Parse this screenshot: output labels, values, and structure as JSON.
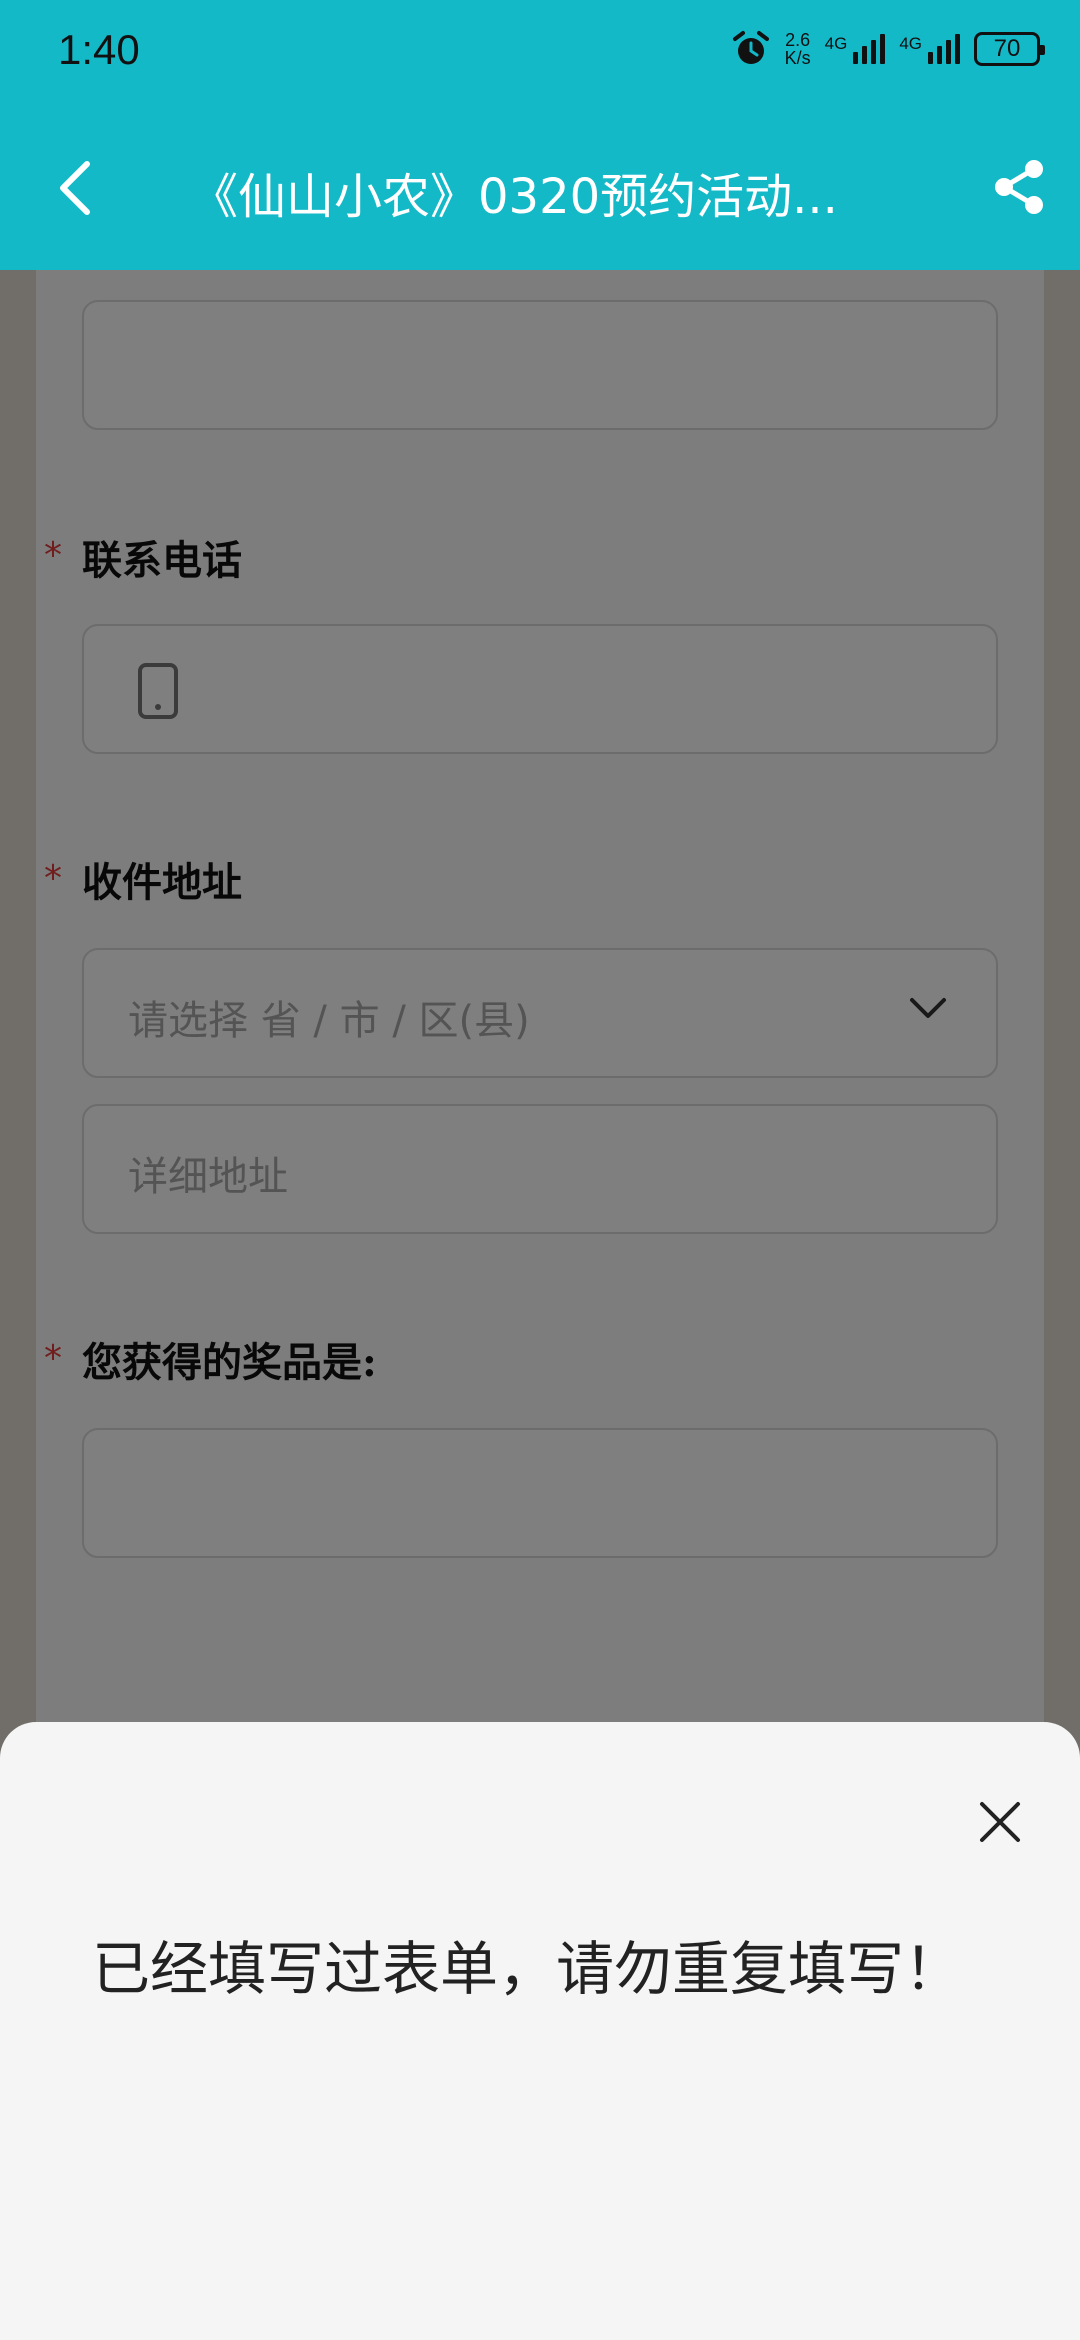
{
  "status_bar": {
    "time": "1:40",
    "net_speed_value": "2.6",
    "net_speed_unit": "K/s",
    "sim1_tag": "4G",
    "sim2_tag": "4G",
    "battery": "70"
  },
  "app_bar": {
    "title": "《仙山小农》0320预约活动...",
    "back_icon": "chevron-left-icon",
    "share_icon": "share-icon"
  },
  "form": {
    "phone": {
      "label": "联系电话",
      "required_mark": "*"
    },
    "address": {
      "label": "收件地址",
      "required_mark": "*",
      "region_placeholder": "请选择 省 / 市 / 区(县)",
      "detail_placeholder": "详细地址"
    },
    "prize": {
      "label": "您获得的奖品是:",
      "required_mark": "*"
    }
  },
  "dialog": {
    "message": "已经填写过表单，请勿重复填写！",
    "close_icon": "close-icon"
  },
  "colors": {
    "brand": "#14b9c8",
    "required": "#e23b3b",
    "sheet_bg": "#f5f5f5"
  }
}
